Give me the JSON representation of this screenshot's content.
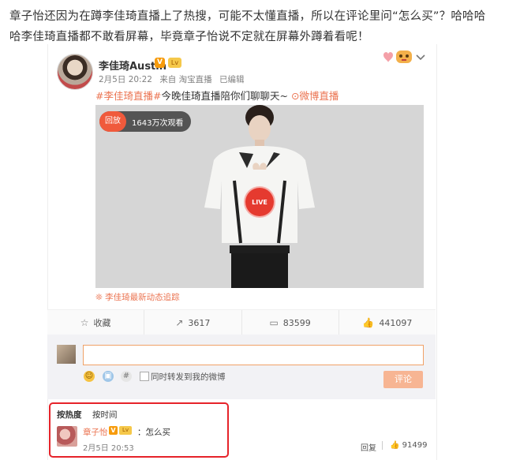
{
  "intro_text": "章子怡还因为在蹲李佳琦直播上了热搜，可能不太懂直播，所以在评论里问“怎么买”？哈哈哈哈李佳琦直播都不敢看屏幕，毕竟章子怡说不定就在屏幕外蹲着看呢！",
  "post": {
    "username": "李佳琦Austin",
    "v_badge": "V",
    "level_badge": "Lv",
    "meta": {
      "date": "2月5日 20:22",
      "source": "来自 淘宝直播",
      "edited": "已编辑"
    },
    "tag": "#李佳琦直播#",
    "text": "今晚佳琦直播陪你们聊聊天~",
    "link": "⊙微博直播",
    "video": {
      "replay_label": "回放",
      "views": "1643万次观看",
      "live_label": "LIVE"
    },
    "video_footer": "❊ 李佳琦最新动态追踪"
  },
  "actions": [
    {
      "icon": "star-icon",
      "glyph": "☆",
      "label": "收藏"
    },
    {
      "icon": "share-icon",
      "glyph": "↗",
      "label": "3617"
    },
    {
      "icon": "comment-icon",
      "glyph": "▭",
      "label": "83599"
    },
    {
      "icon": "like-icon",
      "glyph": "👍",
      "label": "441097"
    }
  ],
  "composer": {
    "input_value": "",
    "forward_label": "同时转发到我的微博",
    "submit_label": "评论"
  },
  "comments_sort": {
    "hot": "按热度",
    "time": "按时间"
  },
  "comment": {
    "name": "章子怡",
    "v_badge": "V",
    "level_badge": "Lv",
    "text": "：怎么买",
    "time": "2月5日 20:53",
    "reply_label": "回复",
    "likes": "91499"
  },
  "colors": {
    "accent_orange": "#eb7350",
    "highlight_red": "#e6232a",
    "live_red": "#e53a2f"
  }
}
